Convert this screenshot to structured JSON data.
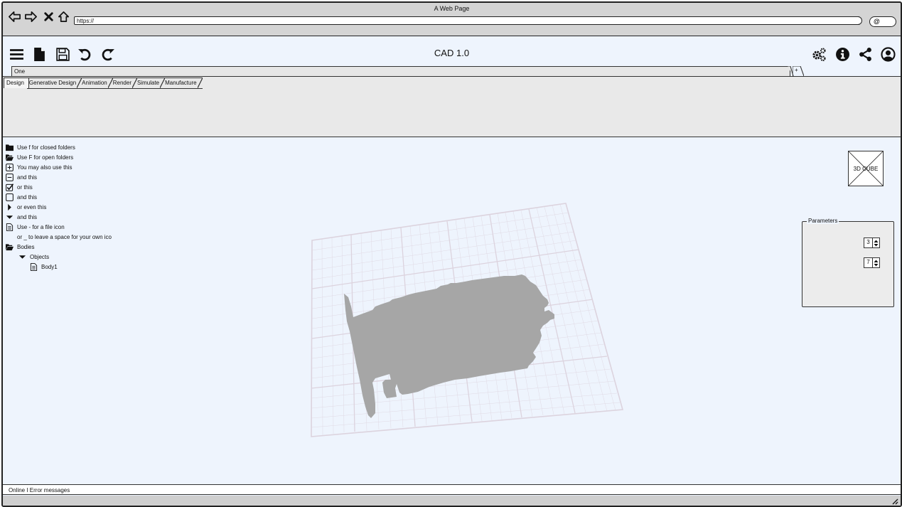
{
  "browser": {
    "window_title": "A Web Page",
    "url": "https://",
    "nav_icons": [
      "back-arrow-icon",
      "forward-arrow-icon",
      "close-icon",
      "home-icon"
    ],
    "search_icon": "search-icon"
  },
  "app": {
    "title": "CAD 1.0",
    "left_tools": [
      "menu-icon",
      "new-file-icon",
      "save-icon",
      "undo-icon",
      "redo-icon"
    ],
    "right_tools": [
      "settings-icon",
      "info-icon",
      "share-icon",
      "user-icon"
    ]
  },
  "documents": {
    "active": "One",
    "add_label": "+"
  },
  "ribbon": {
    "tabs": [
      "Design",
      "Generative Design",
      "Animation",
      "Render",
      "Simulate",
      "Manufacture"
    ]
  },
  "tree": [
    {
      "icon": "folder-closed-icon",
      "label": "Use f for closed folders"
    },
    {
      "icon": "folder-open-icon",
      "label": "Use F for open folders"
    },
    {
      "icon": "plus-box-icon",
      "label": "You may also use this"
    },
    {
      "icon": "minus-box-icon",
      "label": "and this"
    },
    {
      "icon": "checkbox-checked-icon",
      "label": "or this"
    },
    {
      "icon": "checkbox-empty-icon",
      "label": "and this"
    },
    {
      "icon": "caret-right-icon",
      "label": "or even this"
    },
    {
      "icon": "caret-down-icon",
      "label": "and this"
    },
    {
      "icon": "file-icon",
      "label": "Use - for a file icon"
    },
    {
      "icon": "",
      "label": "or _ to leave a space for your own ico"
    },
    {
      "icon": "folder-open-icon",
      "label": "Bodies"
    },
    {
      "icon": "caret-down-icon",
      "label": "Objects"
    },
    {
      "icon": "file-icon",
      "label": "Body1"
    }
  ],
  "viewcube": {
    "label": "3D CUBE"
  },
  "parameters": {
    "legend": "Parameters",
    "values": [
      "3",
      "7"
    ]
  },
  "status": {
    "text": "Online I Error messages"
  },
  "colors": {
    "canvas": "#eef4fd",
    "ribbon": "#e9e9e9",
    "model": "#a6a6a6",
    "grid": "#d9d2dc"
  }
}
